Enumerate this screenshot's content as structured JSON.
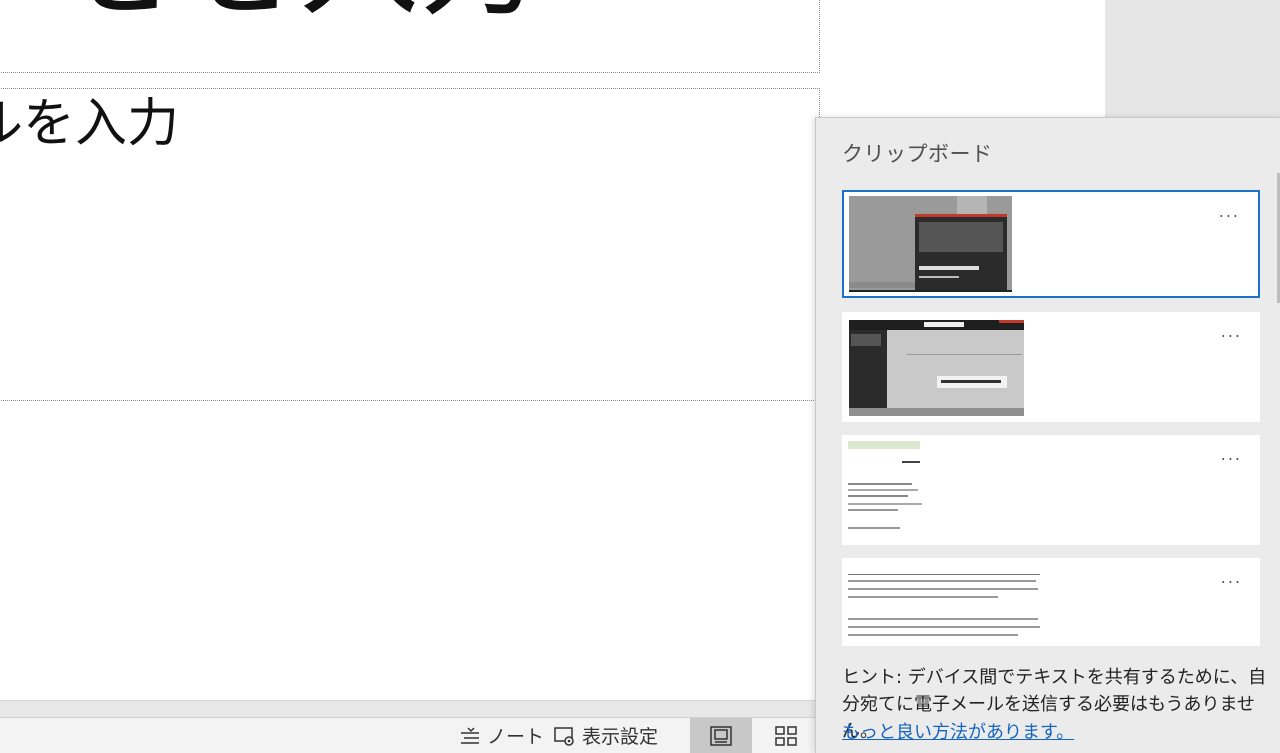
{
  "slide": {
    "title_text": "をを入力",
    "subtitle_text": "ルを入力"
  },
  "statusbar": {
    "notes_label": "ノート",
    "view_settings_label": "表示設定"
  },
  "clipboard": {
    "title": "クリップボード",
    "more_label": "...",
    "hint": "ヒント: デバイス間でテキストを共有するために、自分宛てに電子メールを送信する必要はもうありません。",
    "link": "もっと良い方法があります。",
    "selection_color": "#1a73c9"
  }
}
